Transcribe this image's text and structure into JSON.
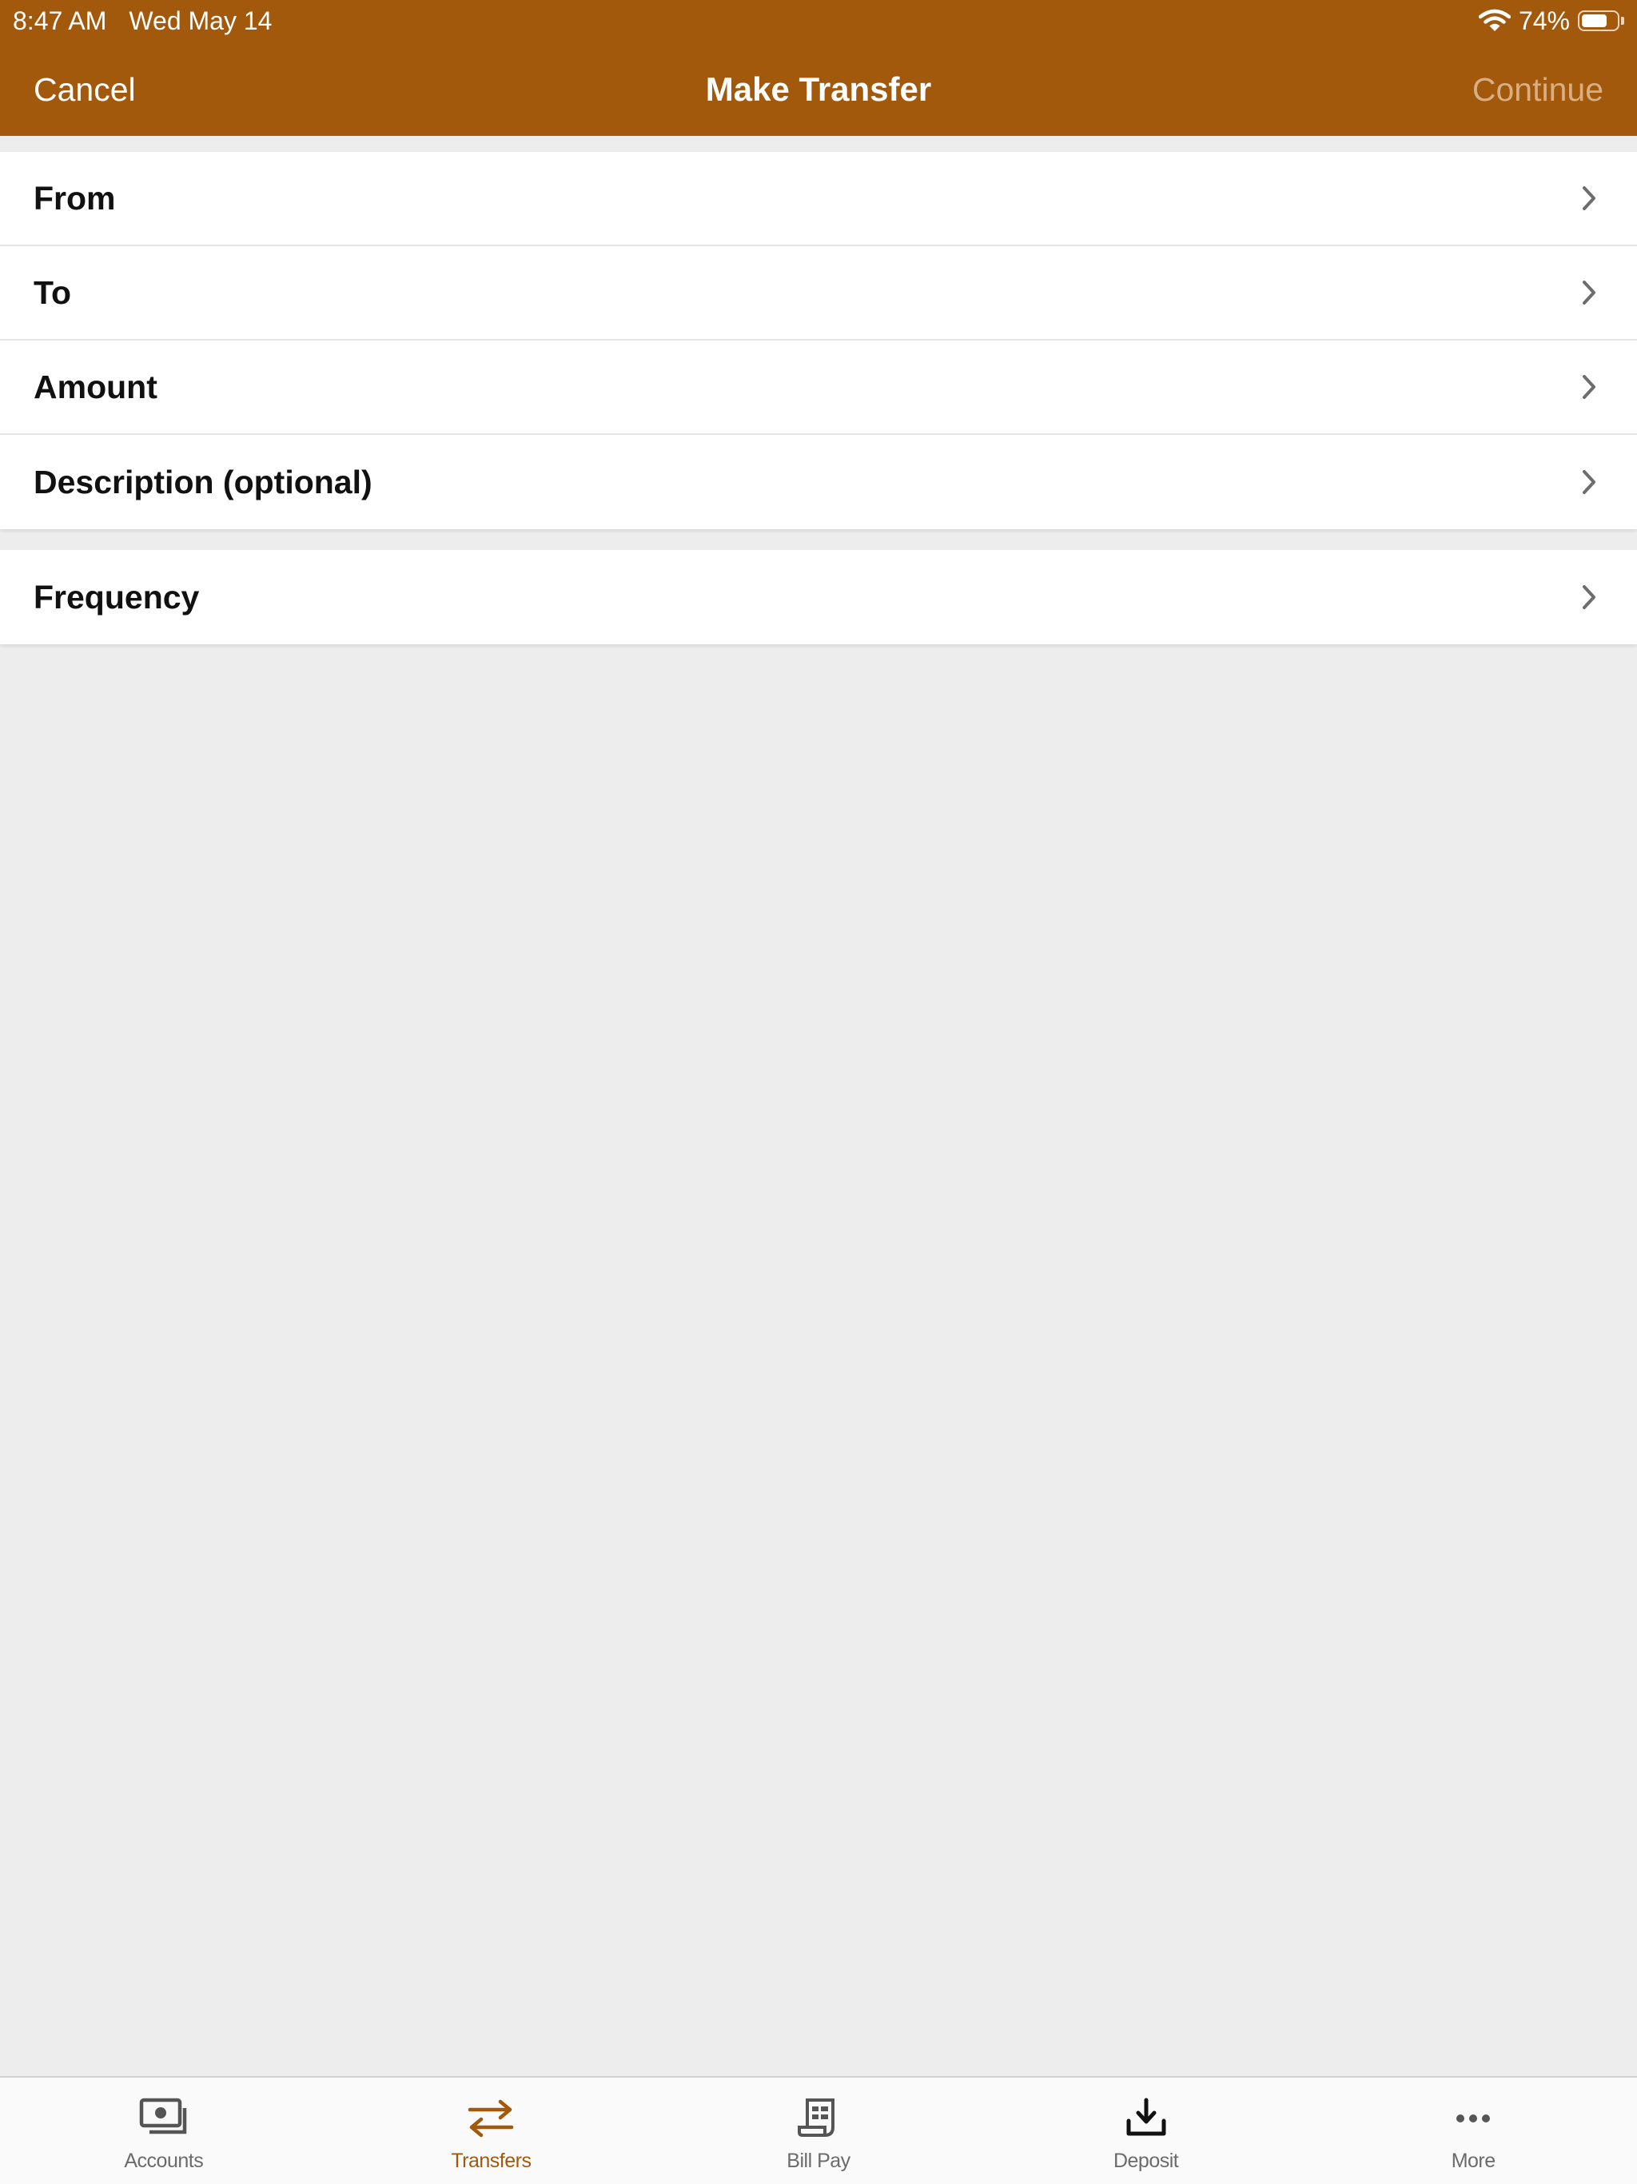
{
  "status_bar": {
    "time": "8:47 AM",
    "date": "Wed May 14",
    "battery_percent": "74%",
    "battery_level": 0.74,
    "wifi_icon": "wifi-icon",
    "battery_icon": "battery-icon"
  },
  "nav": {
    "cancel_label": "Cancel",
    "title": "Make Transfer",
    "continue_label": "Continue"
  },
  "form": {
    "main_rows": [
      {
        "label": "From"
      },
      {
        "label": "To"
      },
      {
        "label": "Amount"
      },
      {
        "label": "Description (optional)"
      }
    ],
    "frequency_row": {
      "label": "Frequency"
    }
  },
  "tabbar": {
    "tabs": [
      {
        "label": "Accounts",
        "icon": "accounts-icon"
      },
      {
        "label": "Transfers",
        "icon": "transfers-icon"
      },
      {
        "label": "Bill Pay",
        "icon": "bill-pay-icon"
      },
      {
        "label": "Deposit",
        "icon": "deposit-icon"
      },
      {
        "label": "More",
        "icon": "more-icon"
      }
    ],
    "active_index": 1
  },
  "colors": {
    "brand": "#a3590b",
    "continue_disabled": "#d8ae84",
    "background": "#ededed",
    "tab_inactive": "#6b6b6b"
  }
}
